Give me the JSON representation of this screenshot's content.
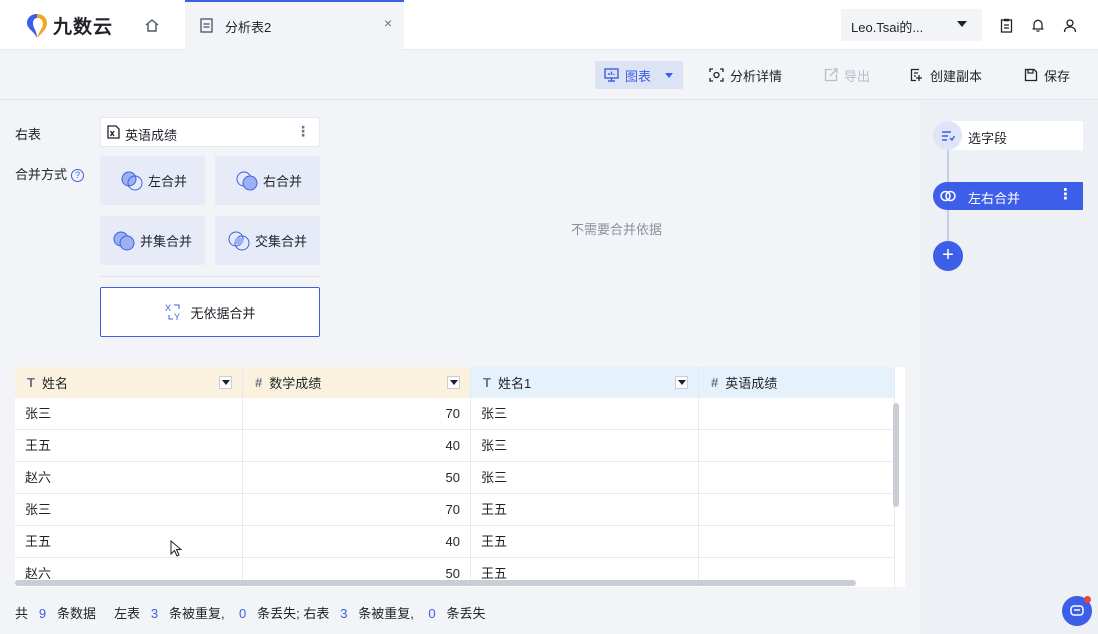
{
  "app": {
    "logo_text": "九数云",
    "brand_color": "#3d5ee8"
  },
  "tab": {
    "label": "分析表2",
    "close": "×"
  },
  "user": {
    "name": "Leo.Tsai的..."
  },
  "toolbar": {
    "chart_label": "图表",
    "detail_label": "分析详情",
    "export_label": "导出",
    "copy_label": "创建副本",
    "save_label": "保存"
  },
  "config": {
    "right_table_label": "右表",
    "right_table_value": "英语成绩",
    "merge_mode_label": "合并方式",
    "help": "?",
    "options": {
      "left": "左合并",
      "right": "右合并",
      "union": "并集合并",
      "intersect": "交集合并"
    },
    "no_ref_label": "无依据合并",
    "no_need_text": "不需要合并依据"
  },
  "flow": {
    "step1": "选字段",
    "step2": "左右合并",
    "add": "+"
  },
  "table": {
    "columns": [
      {
        "name": "姓名",
        "type": "T"
      },
      {
        "name": "数学成绩",
        "type": "#"
      },
      {
        "name": "姓名1",
        "type": "T"
      },
      {
        "name": "英语成绩",
        "type": "#"
      }
    ],
    "rows": [
      [
        "张三",
        "70",
        "张三",
        ""
      ],
      [
        "王五",
        "40",
        "张三",
        ""
      ],
      [
        "赵六",
        "50",
        "张三",
        ""
      ],
      [
        "张三",
        "70",
        "王五",
        ""
      ],
      [
        "王五",
        "40",
        "王五",
        ""
      ],
      [
        "赵六",
        "50",
        "王五",
        ""
      ]
    ]
  },
  "footer": {
    "total_prefix": "共",
    "total": "9",
    "total_suffix": "条数据",
    "left_label": "左表",
    "left_dup": "3",
    "dup_text": "条被重复,",
    "left_lost": "0",
    "lost_text_mid": "条丢失;",
    "right_label": "右表",
    "right_dup": "3",
    "dup_text2": "条被重复,",
    "right_lost": "0",
    "lost_text_end": "条丢失"
  }
}
